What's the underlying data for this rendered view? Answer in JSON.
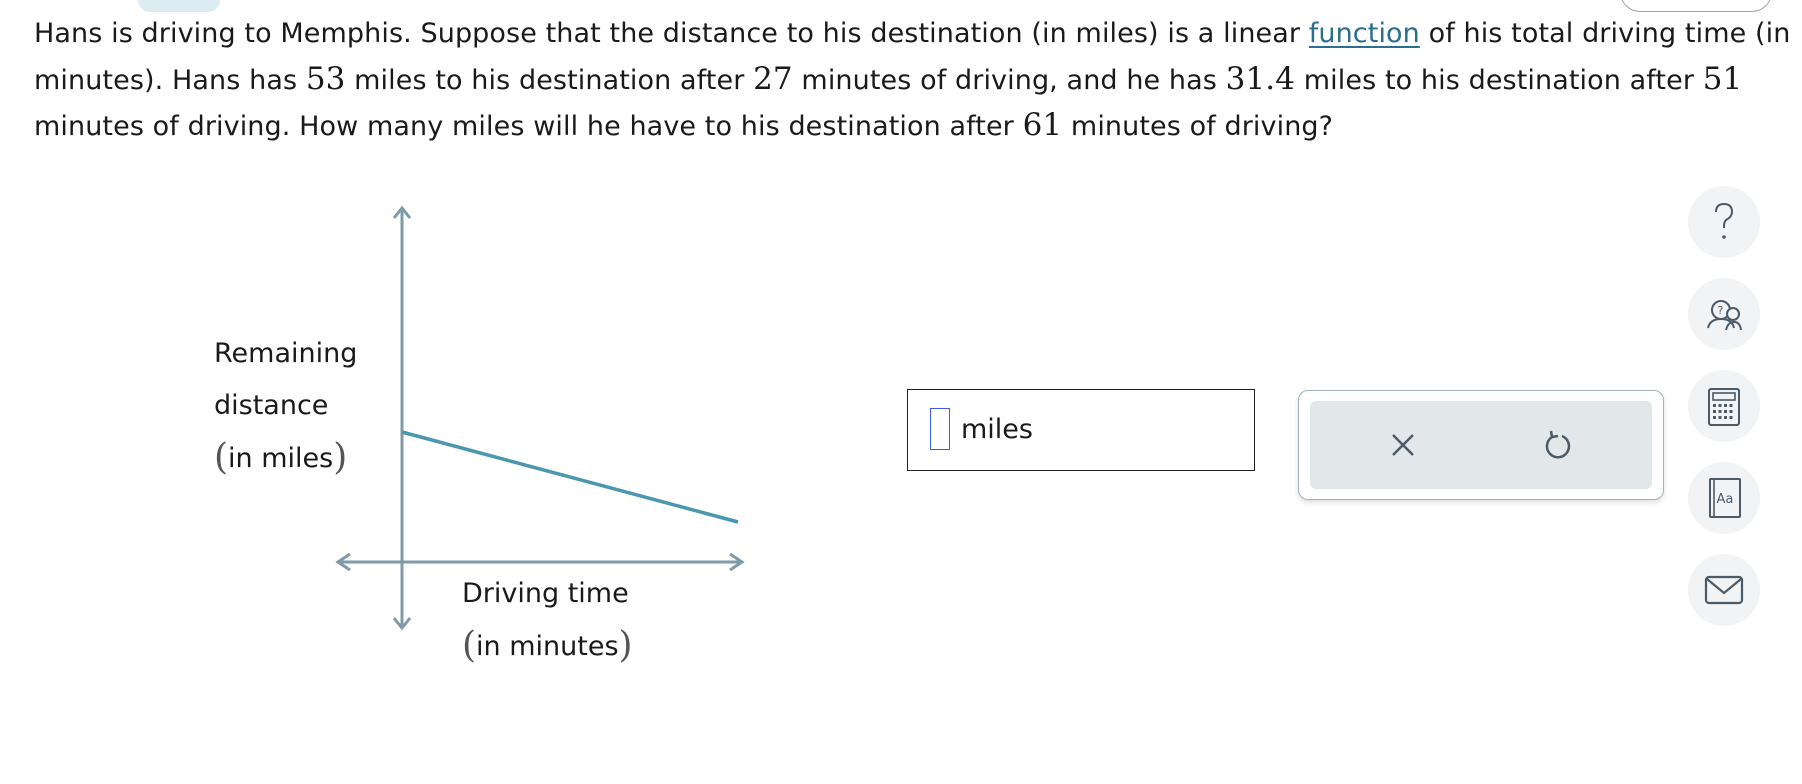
{
  "question": {
    "t1": "Hans is driving to Memphis. Suppose that the distance to his destination (in miles) is a linear ",
    "link": "function",
    "t2": " of his total driving time (in minutes). Hans has ",
    "n1": "53",
    "t3": " miles to his destination after ",
    "n2": "27",
    "t4": " minutes of driving, and he has ",
    "n3": "31.4",
    "t5": " miles to his destination after ",
    "n4": "51",
    "t6": " minutes of driving. How many miles will he have to his destination after ",
    "n5": "61",
    "t7": " minutes of driving?"
  },
  "graph": {
    "y_label_line1": "Remaining",
    "y_label_line2": "distance",
    "y_label_line3_open": "(",
    "y_label_line3": "in miles",
    "y_label_line3_close": ")",
    "x_label_line1": "Driving time",
    "x_label_line2_open": "(",
    "x_label_line2": "in minutes",
    "x_label_line2_close": ")",
    "axis_color": "#7f9aa8",
    "line_color": "#4a97b0"
  },
  "answer": {
    "value": "",
    "unit": "miles"
  },
  "actions": {
    "clear_icon": "close-icon",
    "undo_icon": "undo-icon"
  },
  "sidebar": {
    "icons": [
      "help-icon",
      "ask-instructor-icon",
      "calculator-icon",
      "dictionary-icon",
      "mail-icon"
    ]
  },
  "colors": {
    "link": "#2b6f8e",
    "input_border": "#3b5de7",
    "panel_bg": "#e2e7ea"
  }
}
